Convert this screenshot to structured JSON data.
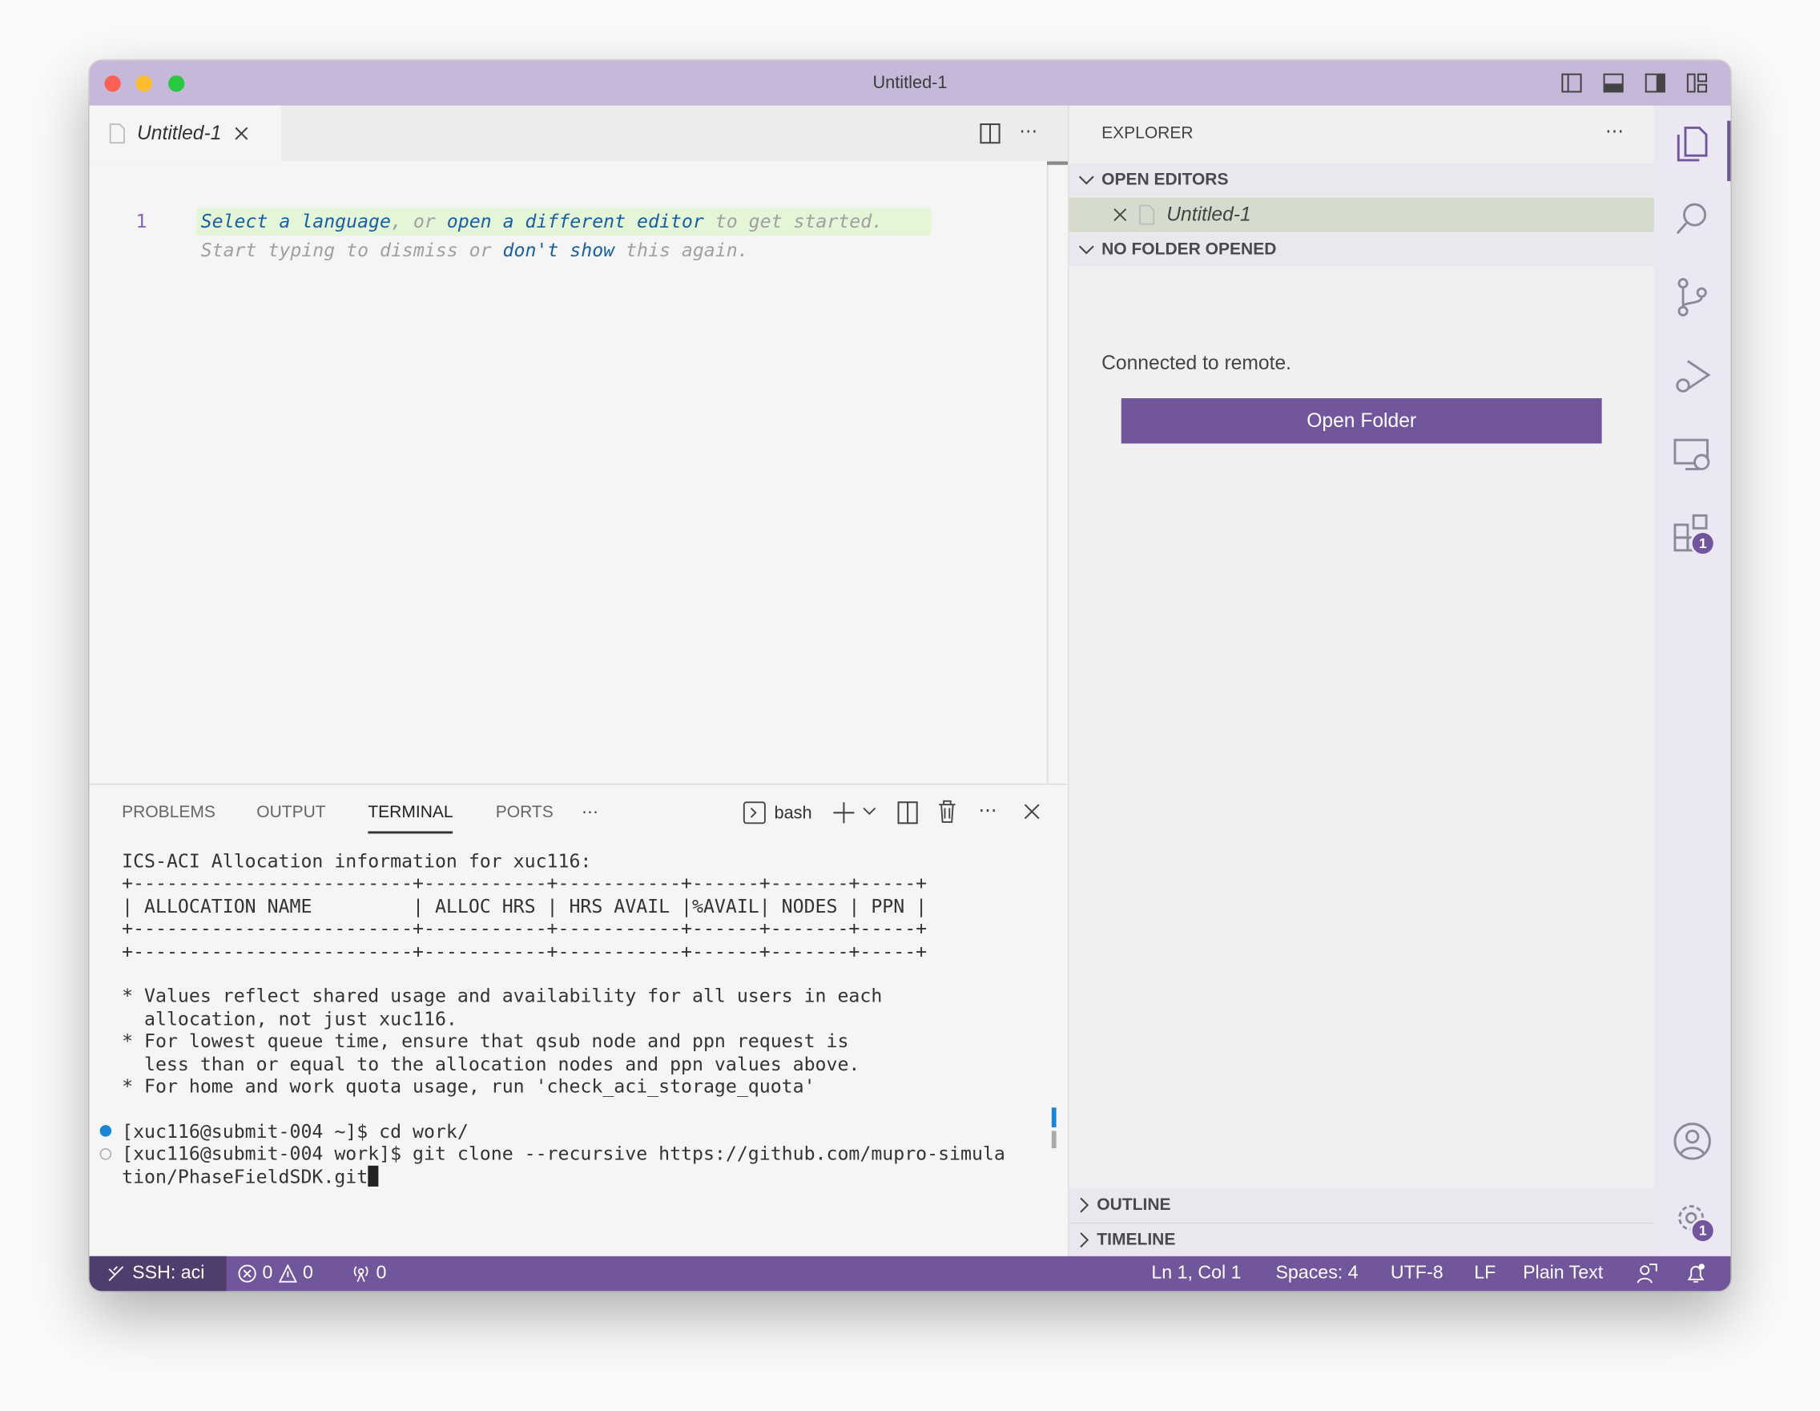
{
  "window": {
    "title": "Untitled-1"
  },
  "editor": {
    "tab_label": "Untitled-1",
    "line_number": "1",
    "hint_line1": {
      "link1": "Select a language",
      "sep1": ", or ",
      "link2": "open a different editor",
      "rest": " to get started."
    },
    "hint_line2": {
      "pre": "Start typing to dismiss or ",
      "link": "don't show",
      "rest": " this again."
    }
  },
  "sidebar": {
    "title": "EXPLORER",
    "open_editors": "OPEN EDITORS",
    "open_editor_item": "Untitled-1",
    "no_folder": "NO FOLDER OPENED",
    "message": "Connected to remote.",
    "open_folder_button": "Open Folder",
    "outline": "OUTLINE",
    "timeline": "TIMELINE"
  },
  "activity_bar": {
    "extensions_badge": "1",
    "settings_badge": "1"
  },
  "panel": {
    "tabs": [
      "PROBLEMS",
      "OUTPUT",
      "TERMINAL",
      "PORTS"
    ],
    "active_tab": "TERMINAL",
    "shell": "bash",
    "terminal_lines": [
      "ICS-ACI Allocation information for xuc116:",
      "+-------------------------+-----------+-----------+------+-------+-----+",
      "| ALLOCATION NAME         | ALLOC HRS | HRS AVAIL |%AVAIL| NODES | PPN |",
      "+-------------------------+-----------+-----------+------+-------+-----+",
      "+-------------------------+-----------+-----------+------+-------+-----+",
      "",
      "",
      "* Values reflect shared usage and availability for all users in each",
      "  allocation, not just xuc116.",
      "* For lowest queue time, ensure that qsub node and ppn request is",
      "  less than or equal to the allocation nodes and ppn values above.",
      "* For home and work quota usage, run 'check_aci_storage_quota'",
      "",
      "[xuc116@submit-004 ~]$ cd work/",
      "[xuc116@submit-004 work]$ git clone --recursive https://github.com/mupro-simula",
      "tion/PhaseFieldSDK.git"
    ]
  },
  "status_bar": {
    "remote": "SSH: aci",
    "errors": "0",
    "warnings": "0",
    "ports": "0",
    "position": "Ln 1, Col 1",
    "spaces": "Spaces: 4",
    "encoding": "UTF-8",
    "eol": "LF",
    "language": "Plain Text"
  },
  "colors": {
    "accent": "#72569b",
    "titlebar": "#c5b8d8",
    "remote": "#4f3d6d"
  }
}
